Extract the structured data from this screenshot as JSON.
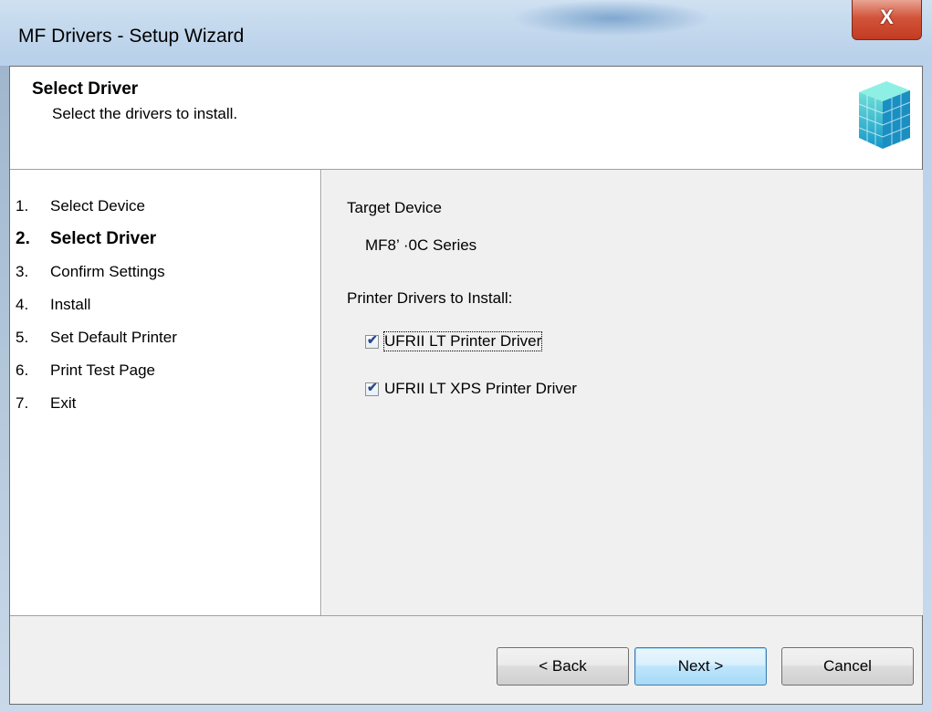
{
  "window": {
    "title": "MF Drivers - Setup Wizard",
    "close_glyph": "X"
  },
  "header": {
    "title": "Select Driver",
    "subtitle": "Select the drivers to install.",
    "icon": "cube-grid-icon"
  },
  "steps": [
    {
      "num": "1.",
      "label": "Select Device"
    },
    {
      "num": "2.",
      "label": "Select Driver"
    },
    {
      "num": "3.",
      "label": "Confirm Settings"
    },
    {
      "num": "4.",
      "label": "Install"
    },
    {
      "num": "5.",
      "label": "Set Default Printer"
    },
    {
      "num": "6.",
      "label": "Print Test Page"
    },
    {
      "num": "7.",
      "label": "Exit"
    }
  ],
  "current_step": 2,
  "content": {
    "target_device_label": "Target Device",
    "target_device_value": "MF8’ ·0C Series",
    "drivers_label": "Printer Drivers to Install:",
    "drivers": [
      {
        "label": "UFRII LT Printer Driver",
        "checked": true
      },
      {
        "label": "UFRII LT XPS Printer Driver",
        "checked": true
      }
    ]
  },
  "buttons": {
    "back": "< Back",
    "next": "Next >",
    "cancel": "Cancel"
  },
  "colors": {
    "client_bg": "#f0f0f0",
    "close_red": "#c23b21",
    "default_button": "#3c7fb1"
  }
}
